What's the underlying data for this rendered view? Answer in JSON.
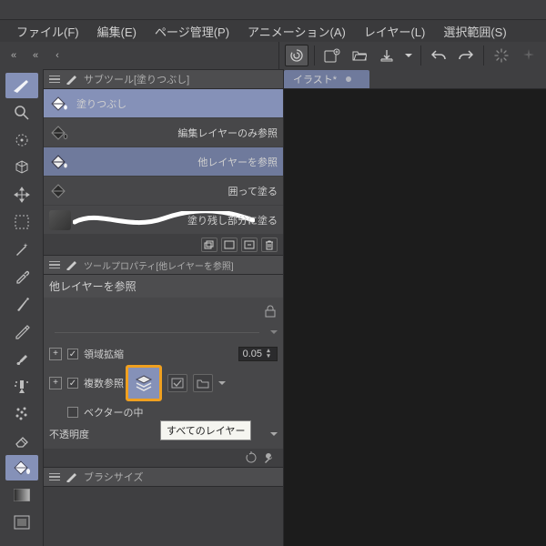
{
  "menu": {
    "file": "ファイル(F)",
    "edit": "編集(E)",
    "page": "ページ管理(P)",
    "anim": "アニメーション(A)",
    "layer": "レイヤー(L)",
    "select": "選択範囲(S)"
  },
  "subtool_panel_title": "サブツール[塗りつぶし]",
  "subtools": [
    {
      "label": "塗りつぶし"
    },
    {
      "label": "編集レイヤーのみ参照"
    },
    {
      "label": "他レイヤーを参照"
    },
    {
      "label": "囲って塗る"
    },
    {
      "label": "塗り残し部分に塗る"
    }
  ],
  "toolprop_panel_title": "ツールプロパティ[他レイヤーを参照]",
  "toolprop_header": "他レイヤーを参照",
  "prop": {
    "area_shrink": "領域拡縮",
    "area_shrink_val": "0.05",
    "multi_ref": "複数参照",
    "vector": "ベクターの中",
    "opacity": "不透明度"
  },
  "tooltip": "すべてのレイヤー",
  "brush_panel_title": "ブラシサイズ",
  "doctab": "イラスト*"
}
